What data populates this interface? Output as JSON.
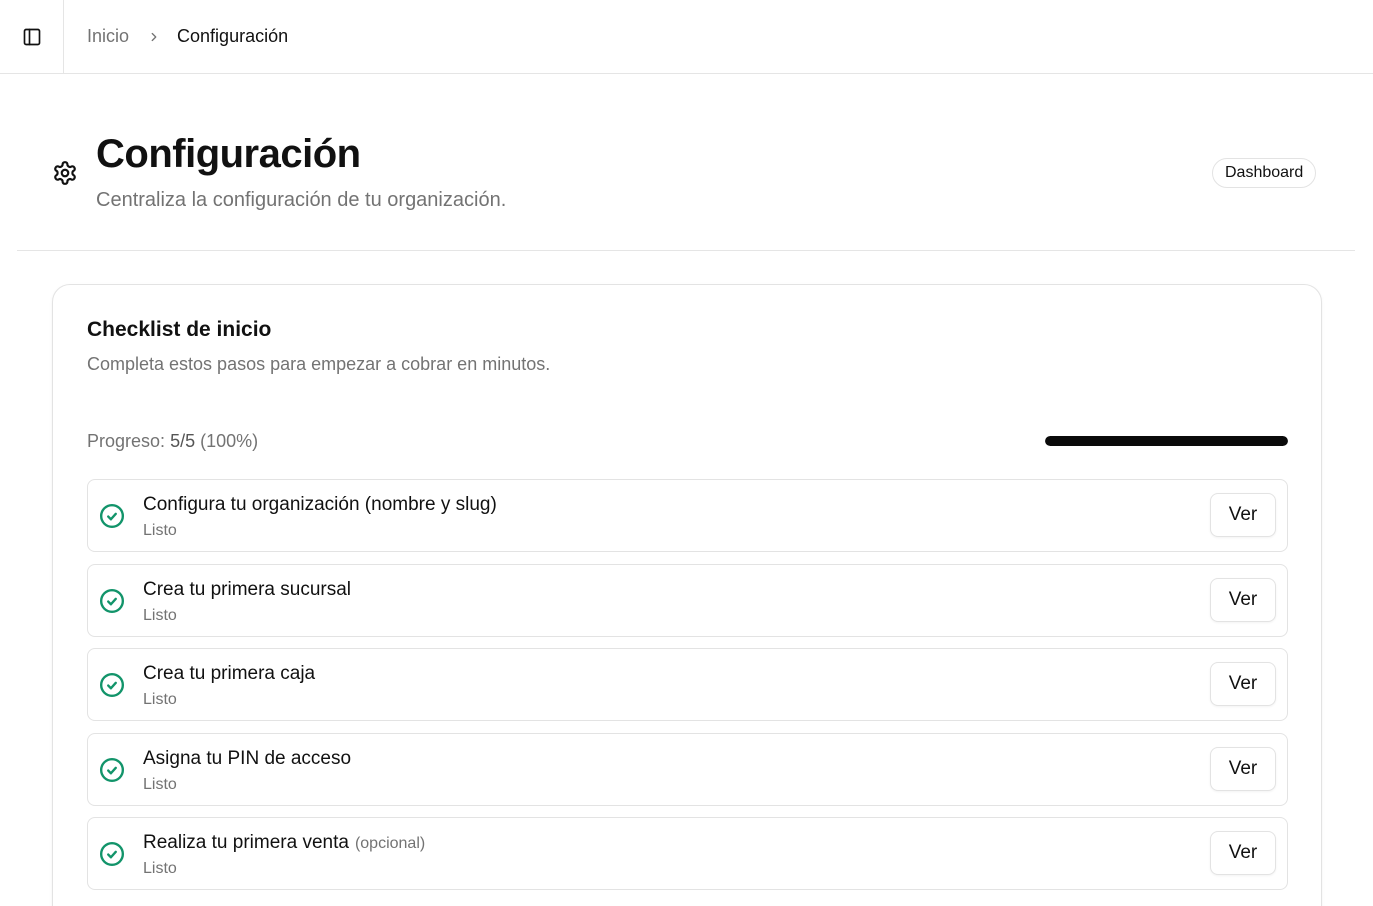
{
  "topbar": {
    "sidebar_toggle_icon": "sidebar-panel-icon",
    "breadcrumb": {
      "home": "Inicio",
      "separator_icon": "chevron-right-icon",
      "current": "Configuración"
    }
  },
  "header": {
    "icon": "gear-icon",
    "title": "Configuración",
    "subtitle": "Centraliza la configuración de tu organización.",
    "dashboard_button": "Dashboard"
  },
  "checklist": {
    "title": "Checklist de inicio",
    "description": "Completa estos pasos para empezar a cobrar en minutos.",
    "progress_label": "Progreso:",
    "progress_count": "5/5",
    "progress_percent": "(100%)",
    "progress_value": 1.0,
    "steps": [
      {
        "title": "Configura tu organización (nombre y slug)",
        "optional": "",
        "status": "Listo",
        "action": "Ver",
        "icon": "check-circle-icon"
      },
      {
        "title": "Crea tu primera sucursal",
        "optional": "",
        "status": "Listo",
        "action": "Ver",
        "icon": "check-circle-icon"
      },
      {
        "title": "Crea tu primera caja",
        "optional": "",
        "status": "Listo",
        "action": "Ver",
        "icon": "check-circle-icon"
      },
      {
        "title": "Asigna tu PIN de acceso",
        "optional": "",
        "status": "Listo",
        "action": "Ver",
        "icon": "check-circle-icon"
      },
      {
        "title": "Realiza tu primera venta",
        "optional": "(opcional)",
        "status": "Listo",
        "action": "Ver",
        "icon": "check-circle-icon"
      }
    ]
  },
  "colors": {
    "accent": "#0a0a0a",
    "success": "#12946a",
    "muted_text": "#737373",
    "border": "#e3e3e3"
  }
}
